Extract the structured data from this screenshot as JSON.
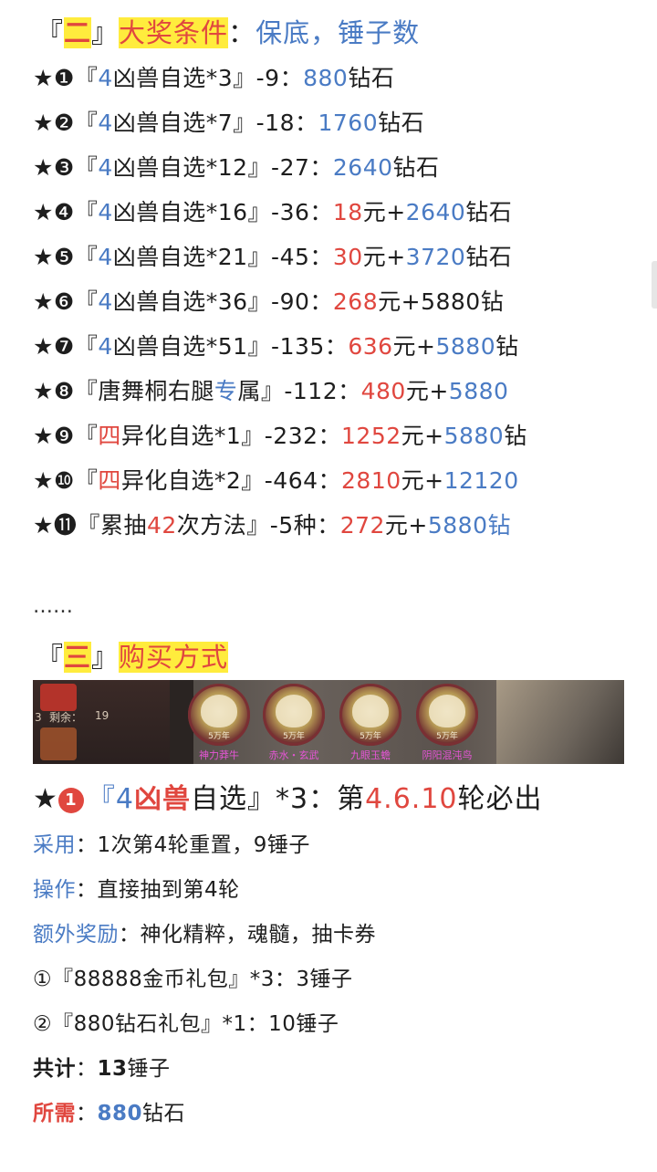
{
  "section2": {
    "open": "『",
    "num": "二",
    "close": "』",
    "title": "大奖条件",
    "colon": "：",
    "subtitle": "保底，锤子数"
  },
  "prize_rows": [
    {
      "mark": "★❶",
      "a": "『",
      "b": "4",
      "c": "凶兽自选*3』-9：",
      "d": "880",
      "e": "钻石",
      "f": "",
      "g": ""
    },
    {
      "mark": "★❷",
      "a": "『",
      "b": "4",
      "c": "凶兽自选*7』-18：",
      "d": "1760",
      "e": "钻石",
      "f": "",
      "g": ""
    },
    {
      "mark": "★❸",
      "a": "『",
      "b": "4",
      "c": "凶兽自选*12』-27：",
      "d": "2640",
      "e": "钻石",
      "f": "",
      "g": ""
    },
    {
      "mark": "★❹",
      "a": "『",
      "b": "4",
      "c": "凶兽自选*16』-36：",
      "d": "18",
      "e": "元+",
      "f": "2640",
      "g": "钻石"
    },
    {
      "mark": "★❺",
      "a": "『",
      "b": "4",
      "c": "凶兽自选*21』-45：",
      "d": "30",
      "e": "元+",
      "f": "3720",
      "g": "钻石"
    },
    {
      "mark": "★❻",
      "a": "『",
      "b": "4",
      "c": "凶兽自选*36』-90：",
      "d": "268",
      "e": "元+5880钻",
      "f": "",
      "g": ""
    },
    {
      "mark": "★❼",
      "a": "『",
      "b": "4",
      "c": "凶兽自选*51』-135：",
      "d": "636",
      "e": "元+",
      "f": "5880",
      "g": "钻"
    },
    {
      "mark": "★❽",
      "a": "『",
      "b": "唐舞桐右腿",
      "c": "专",
      "d": "属』-112：",
      "e": "480",
      "f": "元+",
      "g": "5880"
    },
    {
      "mark": "★❾",
      "a": "『",
      "b": "四",
      "c": "异化自选*1』-232：",
      "d": "1252",
      "e": "元+",
      "f": "5880",
      "g": "钻"
    },
    {
      "mark": "★❿",
      "a": "『",
      "b": "四",
      "c": "异化自选*2』-464：",
      "d": "2810",
      "e": "元+",
      "f": "12120",
      "g": ""
    },
    {
      "mark": "★⓫",
      "a": "『",
      "b": "累抽",
      "c": "42",
      "d": "次方法』-5种：",
      "e": "272",
      "f": "元+",
      "g": "5880钻"
    }
  ],
  "ellipsis": "……",
  "section3": {
    "open": "『",
    "num": "三",
    "close": "』",
    "title": "购买方式"
  },
  "banner": {
    "remain_label": "剩余：",
    "remain_value": "19",
    "left_num": "3",
    "medals": [
      {
        "tag": "5万年",
        "name": "神力莽牛"
      },
      {
        "tag": "5万年",
        "name": "赤水・玄武"
      },
      {
        "tag": "5万年",
        "name": "九眼玉蟾"
      },
      {
        "tag": "5万年",
        "name": "阴阳混沌鸟"
      }
    ]
  },
  "item1": {
    "star": "★",
    "num": "1",
    "p1": "『4",
    "p2": "凶兽",
    "p3": "自选』*3：第",
    "p4": "4.6.10",
    "p5": "轮必出"
  },
  "details": {
    "use_label": "采用",
    "use_text": "：1次第4轮重置，9锤子",
    "op_label": "操作",
    "op_text": "：直接抽到第4轮",
    "extra_label": "额外奖励",
    "extra_text": "：神化精粹，魂髓，抽卡券",
    "gift1": "①『88888金币礼包』*3：3锤子",
    "gift2": "②『880钻石礼包』*1：10锤子",
    "total_label": "共计",
    "total_colon": "：",
    "total_num": "13",
    "total_unit": "锤子",
    "need_label": "所需",
    "need_colon": "：",
    "need_num": "880",
    "need_unit": "钻石"
  },
  "colors": {
    "blue": "#4a7bc4",
    "red": "#e0473f",
    "highlight": "#ffec3d"
  }
}
